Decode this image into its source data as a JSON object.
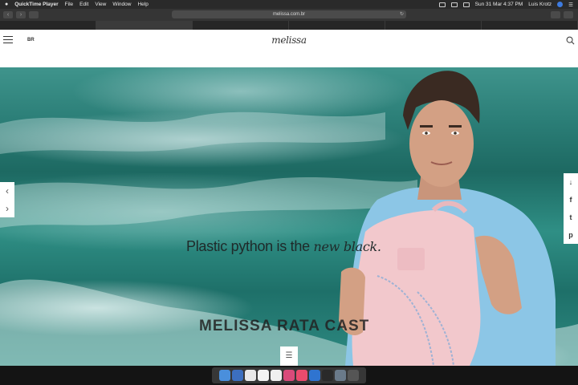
{
  "menubar": {
    "apple": "",
    "items": [
      "QuickTime Player",
      "File",
      "Edit",
      "View",
      "Window",
      "Help"
    ],
    "clock": "Sun 31 Mar  4:37 PM",
    "user": "Luis Krotz"
  },
  "browser": {
    "url": "melissa.com.br",
    "tabs": [
      "",
      "",
      "",
      "",
      "",
      ""
    ]
  },
  "site": {
    "country": "BR",
    "logo": "melissa"
  },
  "hero": {
    "tagline_main": "Plastic python is the ",
    "tagline_em": "new black.",
    "subheadline": "MELISSA RATA CAST",
    "nav_prev": "‹",
    "nav_next": "›",
    "scroll_down": "↓",
    "share": [
      "f",
      "t",
      "p"
    ]
  },
  "colors": {
    "sea": "#2b7e77",
    "bag": "#f2c8cc",
    "shirt": "#8cc6e6"
  }
}
